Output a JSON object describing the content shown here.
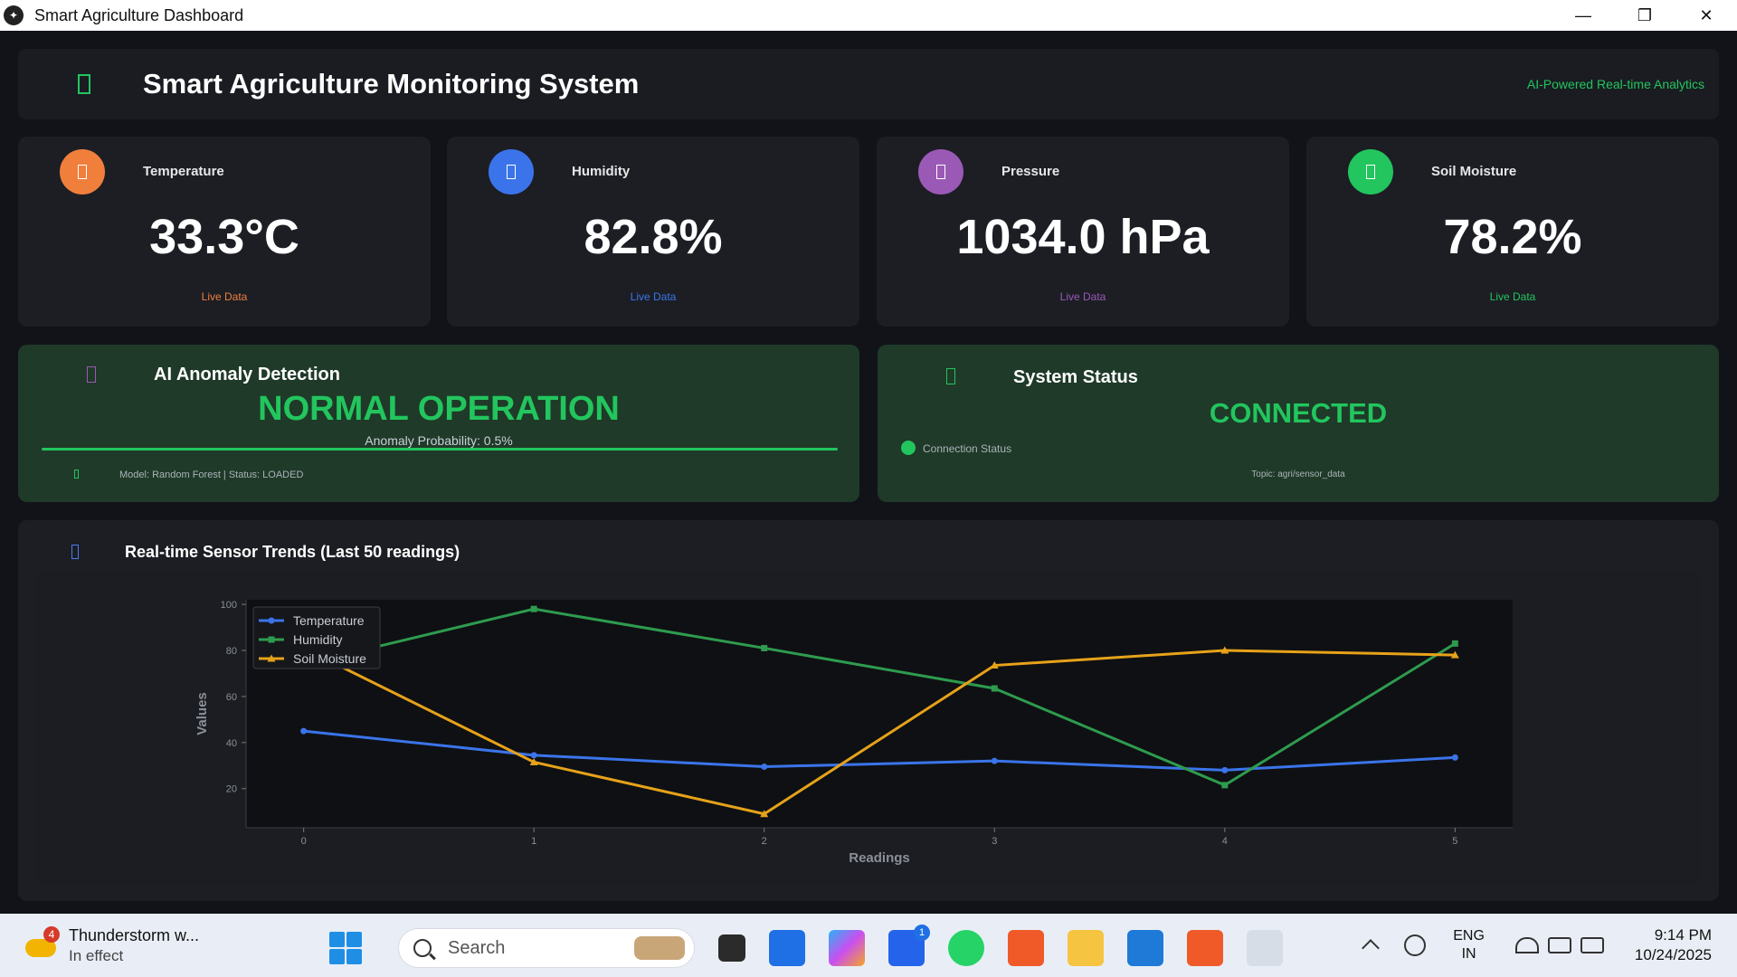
{
  "window": {
    "title": "Smart Agriculture Dashboard",
    "minimize": "—",
    "restore": "❐",
    "close": "✕"
  },
  "header": {
    "title": "Smart Agriculture Monitoring System",
    "subtitle": "AI-Powered Real-time Analytics"
  },
  "cards": [
    {
      "label": "Temperature",
      "value": "33.3°C",
      "live": "Live Data",
      "color": "#f07f3c",
      "icon": "thermometer-icon"
    },
    {
      "label": "Humidity",
      "value": "82.8%",
      "live": "Live Data",
      "color": "#3b74ea",
      "icon": "droplet-icon"
    },
    {
      "label": "Pressure",
      "value": "1034.0 hPa",
      "live": "Live Data",
      "color": "#9b59b6",
      "icon": "gauge-icon"
    },
    {
      "label": "Soil Moisture",
      "value": "78.2%",
      "live": "Live Data",
      "color": "#22c55e",
      "icon": "seedling-icon"
    }
  ],
  "anomaly": {
    "title": "AI Anomaly Detection",
    "status": "NORMAL OPERATION",
    "probability": "Anomaly Probability: 0.5%",
    "model": "Model: Random Forest | Status: LOADED"
  },
  "system": {
    "title": "System Status",
    "status": "CONNECTED",
    "connection_label": "Connection Status",
    "topic": "Topic: agri/sensor_data"
  },
  "trend": {
    "title": "Real-time Sensor Trends (Last 50 readings)"
  },
  "chart_data": {
    "type": "line",
    "x": [
      0,
      1,
      2,
      3,
      4,
      5
    ],
    "xlabel": "Readings",
    "ylabel": "Values",
    "yticks": [
      20,
      40,
      60,
      80,
      100
    ],
    "ylim": [
      3,
      102
    ],
    "xlim": [
      -0.25,
      5.25
    ],
    "legend": "top-left",
    "series": [
      {
        "name": "Temperature",
        "color": "#3b74ea",
        "marker": "circle",
        "values": [
          45,
          34.5,
          29.5,
          32,
          28,
          33.5
        ]
      },
      {
        "name": "Humidity",
        "color": "#2e9b4e",
        "marker": "square",
        "values": [
          74,
          98,
          81,
          63.5,
          21.5,
          83
        ]
      },
      {
        "name": "Soil Moisture",
        "color": "#e6a21a",
        "marker": "triangle",
        "values": [
          81,
          31.5,
          9,
          73.5,
          80,
          78
        ]
      }
    ]
  },
  "taskbar": {
    "weather_title": "Thunderstorm w...",
    "weather_sub": "In effect",
    "weather_badge": "4",
    "search_placeholder": "Search",
    "todo_badge": "1",
    "lang_1": "ENG",
    "lang_2": "IN",
    "time": "9:14 PM",
    "date": "10/24/2025"
  }
}
